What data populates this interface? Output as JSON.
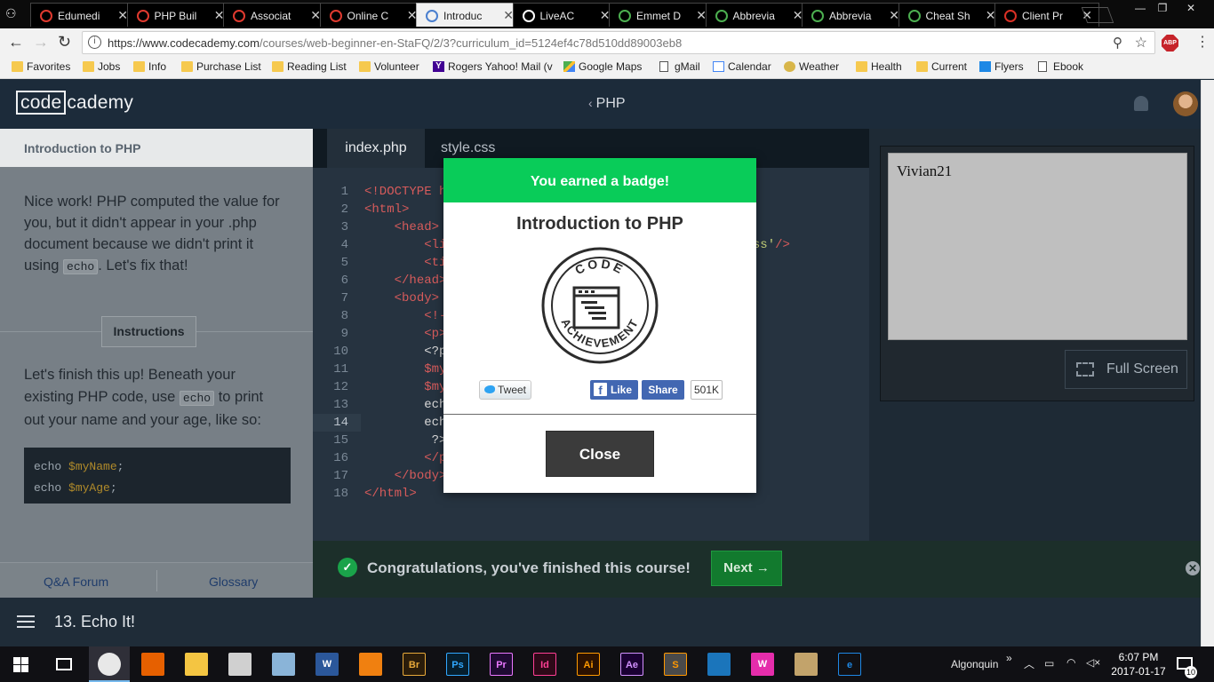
{
  "browser": {
    "tabs": [
      {
        "label": "Edumedi",
        "color": "#e03a2f"
      },
      {
        "label": "PHP Buil",
        "color": "#e03a2f"
      },
      {
        "label": "Associat",
        "color": "#e03a2f"
      },
      {
        "label": "Online C",
        "color": "#e03a2f"
      },
      {
        "label": "Introduc",
        "color": "#4a7fcf"
      },
      {
        "label": "LiveAC",
        "color": "#ffffff"
      },
      {
        "label": "Emmet D",
        "color": "#4caf50"
      },
      {
        "label": "Abbrevia",
        "color": "#4caf50"
      },
      {
        "label": "Abbrevia",
        "color": "#4caf50"
      },
      {
        "label": "Cheat Sh",
        "color": "#4caf50"
      },
      {
        "label": "Client Pr",
        "color": "#d93025"
      }
    ],
    "active_tab_index": 4,
    "url_host": "https://www.codecademy.com",
    "url_path": "/courses/web-beginner-en-StaFQ/2/3?curriculum_id=5124ef4c78d510dd89003eb8",
    "abp_label": "ABP",
    "bookmarks": [
      {
        "label": "Favorites",
        "icon": "folder"
      },
      {
        "label": "Jobs",
        "icon": "folder"
      },
      {
        "label": "Info",
        "icon": "folder"
      },
      {
        "label": "Purchase List",
        "icon": "folder"
      },
      {
        "label": "Reading List",
        "icon": "folder"
      },
      {
        "label": "Volunteer",
        "icon": "folder"
      },
      {
        "label": "Rogers Yahoo! Mail (v",
        "icon": "yahoo"
      },
      {
        "label": "Google Maps",
        "icon": "maps"
      },
      {
        "label": "gMail",
        "icon": "page"
      },
      {
        "label": "Calendar",
        "icon": "cal"
      },
      {
        "label": "Weather",
        "icon": "weather"
      },
      {
        "label": "Health",
        "icon": "folder"
      },
      {
        "label": "Current",
        "icon": "folder"
      },
      {
        "label": "Flyers",
        "icon": "flyers"
      },
      {
        "label": "Ebook",
        "icon": "page"
      }
    ]
  },
  "header": {
    "logo_boxed": "code",
    "logo_rest": "cademy",
    "course": "PHP"
  },
  "lesson": {
    "title": "Introduction to PHP",
    "body_part1": "Nice work! PHP computed the value for you, but it didn't appear in your .php document because we didn't print it using ",
    "body_code": "echo",
    "body_part2": ". Let's fix that!",
    "instructions_label": "Instructions",
    "instr_part1": "Let's finish this up! Beneath your existing PHP code, use ",
    "instr_code": "echo",
    "instr_part2": " to print out your name and your age, like so:",
    "example": [
      {
        "kw": "echo ",
        "var": "$myName",
        "end": ";"
      },
      {
        "kw": "echo ",
        "var": "$myAge",
        "end": ";"
      }
    ],
    "footer_qa": "Q&A Forum",
    "footer_glossary": "Glossary"
  },
  "editor": {
    "tabs": [
      "index.php",
      "style.css"
    ],
    "current_line": 14,
    "line_numbers": [
      "1",
      "2",
      "3",
      "4",
      "5",
      "6",
      "7",
      "8",
      "9",
      "10",
      "11",
      "12",
      "13",
      "14",
      "15",
      "16",
      "17",
      "18"
    ],
    "lines": [
      [
        {
          "t": "<!DOCTYPE h",
          "c": "tag"
        }
      ],
      [
        {
          "t": "<html>",
          "c": "tag"
        }
      ],
      [
        {
          "t": "    "
        },
        {
          "t": "<head>",
          "c": "tag"
        }
      ],
      [
        {
          "t": "        "
        },
        {
          "t": "<li",
          "c": "tag"
        },
        {
          "t": "                                 "
        },
        {
          "t": "'style.css'",
          "c": "str"
        },
        {
          "t": "/>",
          "c": "tag"
        }
      ],
      [
        {
          "t": "        "
        },
        {
          "t": "<ti",
          "c": "tag"
        }
      ],
      [
        {
          "t": "    "
        },
        {
          "t": "</head>",
          "c": "tag"
        }
      ],
      [
        {
          "t": "    "
        },
        {
          "t": "<body>",
          "c": "tag"
        }
      ],
      [
        {
          "t": "        "
        },
        {
          "t": "<!-",
          "c": "tag"
        }
      ],
      [
        {
          "t": "        "
        },
        {
          "t": "<p>",
          "c": "tag"
        }
      ],
      [
        {
          "t": "        "
        },
        {
          "t": "<?p",
          "c": "ph"
        }
      ],
      [
        {
          "t": "        "
        },
        {
          "t": "$my",
          "c": "vr"
        }
      ],
      [
        {
          "t": "        "
        },
        {
          "t": "$my",
          "c": "vr"
        }
      ],
      [
        {
          "t": "        "
        },
        {
          "t": "ech",
          "c": "ph"
        }
      ],
      [
        {
          "t": "        "
        },
        {
          "t": "ech",
          "c": "ph"
        }
      ],
      [
        {
          "t": "         "
        },
        {
          "t": "?>",
          "c": "ph"
        }
      ],
      [
        {
          "t": "        "
        },
        {
          "t": "</p",
          "c": "tag"
        }
      ],
      [
        {
          "t": "    "
        },
        {
          "t": "</body>",
          "c": "tag"
        }
      ],
      [
        {
          "t": "</html>",
          "c": "tag"
        }
      ]
    ]
  },
  "preview": {
    "output": "Vivian21",
    "fullscreen_label": "Full Screen"
  },
  "congrats": {
    "message": "Congratulations, you've finished this course!",
    "next_label": "Next →"
  },
  "bottom": {
    "lesson_name": "13. Echo It!"
  },
  "modal": {
    "heading": "You earned a badge!",
    "badge_title": "Introduction to PHP",
    "badge_top": "CODE",
    "badge_bottom": "ACHIEVEMENT",
    "tweet_label": "Tweet",
    "like_label": "Like",
    "share_label": "Share",
    "share_count": "501K",
    "close_label": "Close"
  },
  "taskbar": {
    "apps": [
      {
        "name": "chrome",
        "label": "",
        "bg": "#e8e8e8"
      },
      {
        "name": "firefox",
        "label": "",
        "bg": "#e66000"
      },
      {
        "name": "explorer",
        "label": "",
        "bg": "#f4c542"
      },
      {
        "name": "paint",
        "label": "",
        "bg": "#d0d0d0"
      },
      {
        "name": "notepad",
        "label": "",
        "bg": "#8ab4d8"
      },
      {
        "name": "word",
        "label": "W",
        "bg": "#2b579a"
      },
      {
        "name": "vlc",
        "label": "",
        "bg": "#f08010"
      },
      {
        "name": "bridge",
        "label": "Br",
        "bg": "#2a1c0a",
        "fg": "#e8a93a"
      },
      {
        "name": "photoshop",
        "label": "Ps",
        "bg": "#061e2d",
        "fg": "#31a8ff"
      },
      {
        "name": "premiere",
        "label": "Pr",
        "bg": "#1f0a33",
        "fg": "#ea77ff"
      },
      {
        "name": "indesign",
        "label": "Id",
        "bg": "#2d0918",
        "fg": "#ff3f94"
      },
      {
        "name": "illustrator",
        "label": "Ai",
        "bg": "#2b1100",
        "fg": "#ff9a00"
      },
      {
        "name": "aftereffects",
        "label": "Ae",
        "bg": "#1a0033",
        "fg": "#d291ff"
      },
      {
        "name": "sublime",
        "label": "S",
        "bg": "#4a4a4a",
        "fg": "#ff9800"
      },
      {
        "name": "app-blue",
        "label": "",
        "bg": "#1b75bb"
      },
      {
        "name": "wamp",
        "label": "W",
        "bg": "#e52dab"
      },
      {
        "name": "app-misc",
        "label": "",
        "bg": "#c2a36b"
      },
      {
        "name": "edge",
        "label": "e",
        "bg": "#101014",
        "fg": "#1e88e5"
      }
    ],
    "tray_label": "Algonquin",
    "time": "6:07 PM",
    "date": "2017-01-17",
    "notifications": "10"
  }
}
